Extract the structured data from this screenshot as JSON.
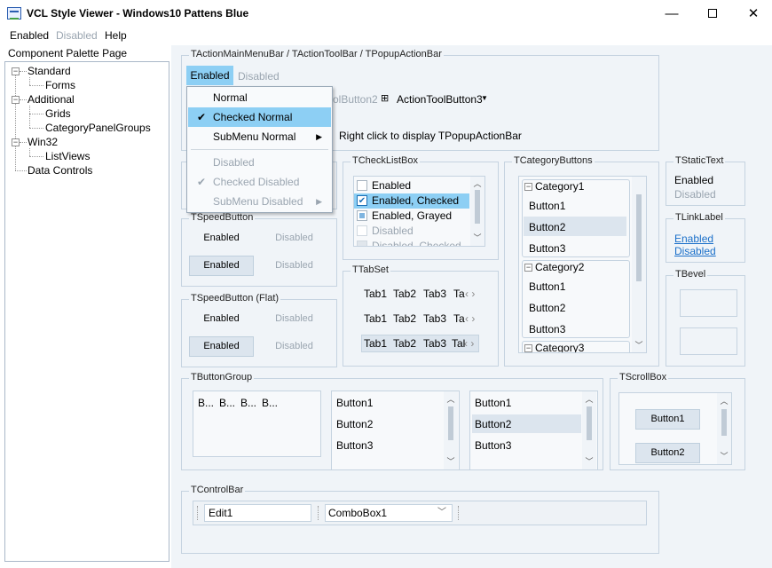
{
  "window": {
    "title": "VCL Style Viewer - Windows10 Pattens Blue",
    "minimize": "—",
    "close": "✕"
  },
  "menu": {
    "items": [
      "Enabled",
      "Disabled",
      "Help"
    ]
  },
  "palette": {
    "label": "Component Palette Page",
    "tree": [
      {
        "label": "Standard"
      },
      {
        "label": "Forms"
      },
      {
        "label": "Additional"
      },
      {
        "label": "Grids"
      },
      {
        "label": "CategoryPanelGroups"
      },
      {
        "label": "Win32"
      },
      {
        "label": "ListViews"
      },
      {
        "label": "Data Controls"
      }
    ]
  },
  "actionbar": {
    "label": "TActionMainMenuBar / TActionToolBar / TPopupActionBar",
    "menu_enabled": "Enabled",
    "menu_disabled": "Disabled",
    "toolbutton2_partial": "olButton2",
    "toolbutton3": "ActionToolButton3",
    "hint": "Right click to display TPopupActionBar"
  },
  "popup": {
    "items": [
      "Normal",
      "Checked Normal",
      "SubMenu Normal",
      "Disabled",
      "Checked Disabled",
      "SubMenu Disabled"
    ],
    "check": "✔",
    "arrow": "▶"
  },
  "speedbutton": {
    "label": "TSpeedButton",
    "enabled": "Enabled",
    "disabled": "Disabled"
  },
  "speedbutton_flat": {
    "label": "TSpeedButton (Flat)",
    "enabled": "Enabled",
    "disabled": "Disabled"
  },
  "checklistbox": {
    "label": "TCheckListBox",
    "items": [
      "Enabled",
      "Enabled, Checked",
      "Enabled, Grayed",
      "Disabled",
      "Disabled, Checked"
    ]
  },
  "tabset": {
    "label": "TTabSet",
    "tabs": [
      "Tab1",
      "Tab2",
      "Tab3",
      "Ta",
      "Tab1",
      "Tab2",
      "Tab3",
      "Ta",
      "Tab1",
      "Tab2",
      "Tab3",
      "Tal"
    ]
  },
  "categorybuttons": {
    "label": "TCategoryButtons",
    "cat1": "Category1",
    "cat2": "Category2",
    "cat3": "Category3",
    "buttons": [
      "Button1",
      "Button2",
      "Button3",
      "Button1",
      "Button2",
      "Button3"
    ]
  },
  "statictext": {
    "label": "TStaticText",
    "enabled": "Enabled",
    "disabled": "Disabled"
  },
  "linklabel": {
    "label": "TLinkLabel",
    "enabled": "Enabled",
    "disabled": "Disabled"
  },
  "bevel": {
    "label": "TBevel"
  },
  "buttongroup": {
    "label": "TButtonGroup",
    "items": [
      "B...",
      "B...",
      "B...",
      "B...",
      "B..."
    ],
    "list1": [
      "Button1",
      "Button2",
      "Button3"
    ],
    "list2": [
      "Button1",
      "Button2",
      "Button3"
    ]
  },
  "scrollbox": {
    "label": "TScrollBox",
    "button1": "Button1",
    "button2": "Button2"
  },
  "controlbar": {
    "label": "TControlBar",
    "edit": "Edit1",
    "combo": "ComboBox1"
  },
  "colors": {
    "accent": "#8dcff4",
    "panel": "#f0f4f8",
    "border": "#c5d3e0"
  }
}
